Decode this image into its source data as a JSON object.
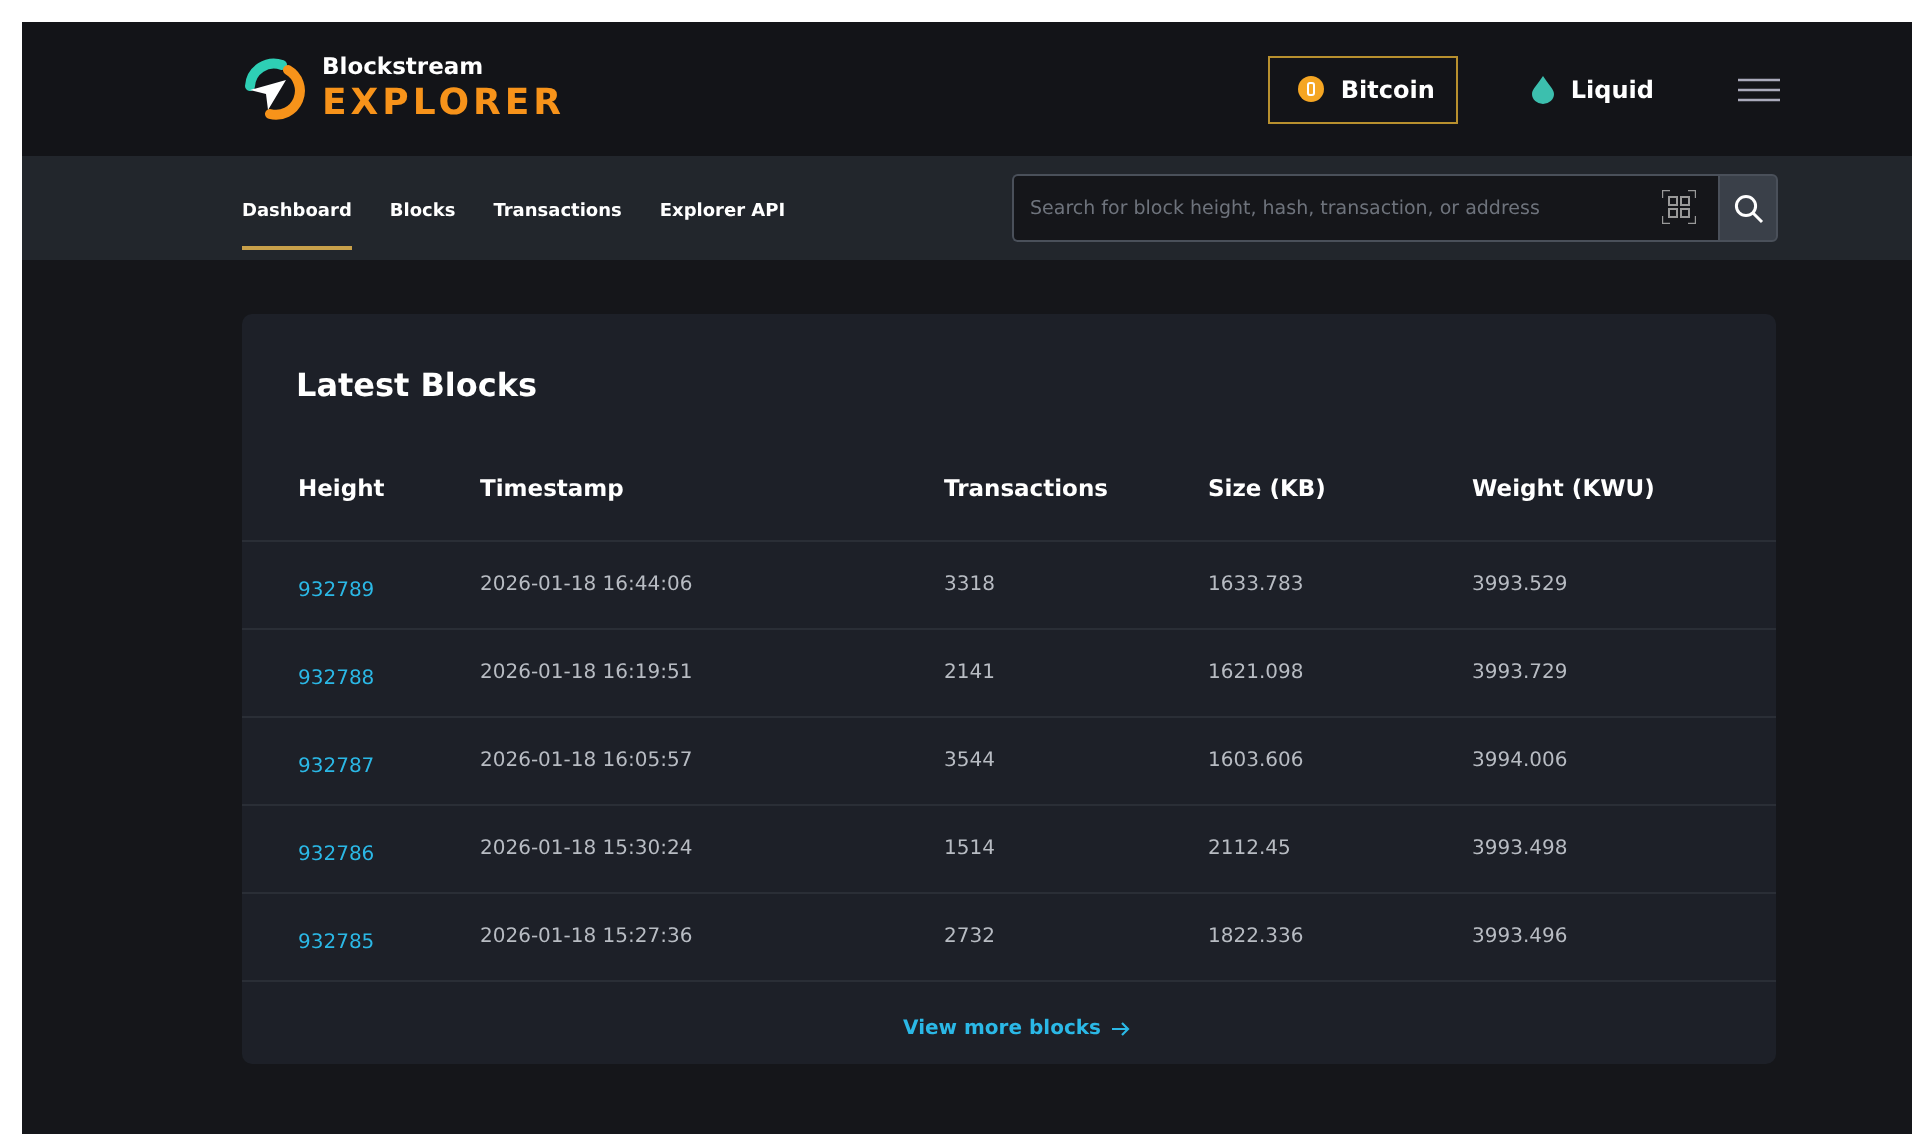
{
  "brand": {
    "name": "Blockstream",
    "product": "EXPLORER"
  },
  "networks": [
    {
      "label": "Bitcoin",
      "kind": "bitcoin",
      "selected": true
    },
    {
      "label": "Liquid",
      "kind": "liquid",
      "selected": false
    }
  ],
  "nav": [
    {
      "label": "Dashboard",
      "selected": true
    },
    {
      "label": "Blocks",
      "selected": false
    },
    {
      "label": "Transactions",
      "selected": false
    },
    {
      "label": "Explorer API",
      "selected": false
    }
  ],
  "search": {
    "placeholder": "Search for block height, hash, transaction, or address"
  },
  "latest_blocks": {
    "title": "Latest Blocks",
    "columns": [
      "Height",
      "Timestamp",
      "Transactions",
      "Size (KB)",
      "Weight (KWU)"
    ],
    "rows": [
      [
        "932789",
        "2026-01-18 16:44:06",
        "3318",
        "1633.783",
        "3993.529"
      ],
      [
        "932788",
        "2026-01-18 16:19:51",
        "2141",
        "1621.098",
        "3993.729"
      ],
      [
        "932787",
        "2026-01-18 16:05:57",
        "3544",
        "1603.606",
        "3994.006"
      ],
      [
        "932786",
        "2026-01-18 15:30:24",
        "1514",
        "2112.45",
        "3993.498"
      ],
      [
        "932785",
        "2026-01-18 15:27:36",
        "2732",
        "1822.336",
        "3993.496"
      ]
    ],
    "more_link": "View more blocks"
  }
}
